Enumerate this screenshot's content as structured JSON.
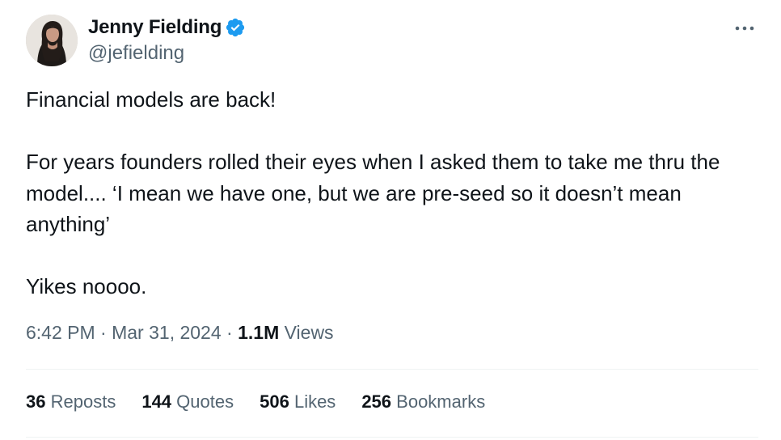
{
  "author": {
    "name": "Jenny Fielding",
    "handle": "@jefielding",
    "verified_icon": "verified-badge-icon",
    "verified_color": "#1d9bf0"
  },
  "tweet": {
    "line1": "Financial models are back!",
    "para2": "For years founders rolled their eyes when I asked them to take me thru the model.... ‘I mean we have one, but we are pre-seed so it doesn’t mean anything’",
    "line3": "Yikes noooo."
  },
  "meta": {
    "time": "6:42 PM",
    "separator": "·",
    "date": "Mar 31, 2024",
    "views_count": "1.1M",
    "views_label": "Views"
  },
  "stats": {
    "reposts_count": "36",
    "reposts_label": "Reposts",
    "quotes_count": "144",
    "quotes_label": "Quotes",
    "likes_count": "506",
    "likes_label": "Likes",
    "bookmarks_count": "256",
    "bookmarks_label": "Bookmarks"
  },
  "colors": {
    "primary_text": "#0f1419",
    "secondary_text": "#536471",
    "divider": "#eff3f4"
  }
}
